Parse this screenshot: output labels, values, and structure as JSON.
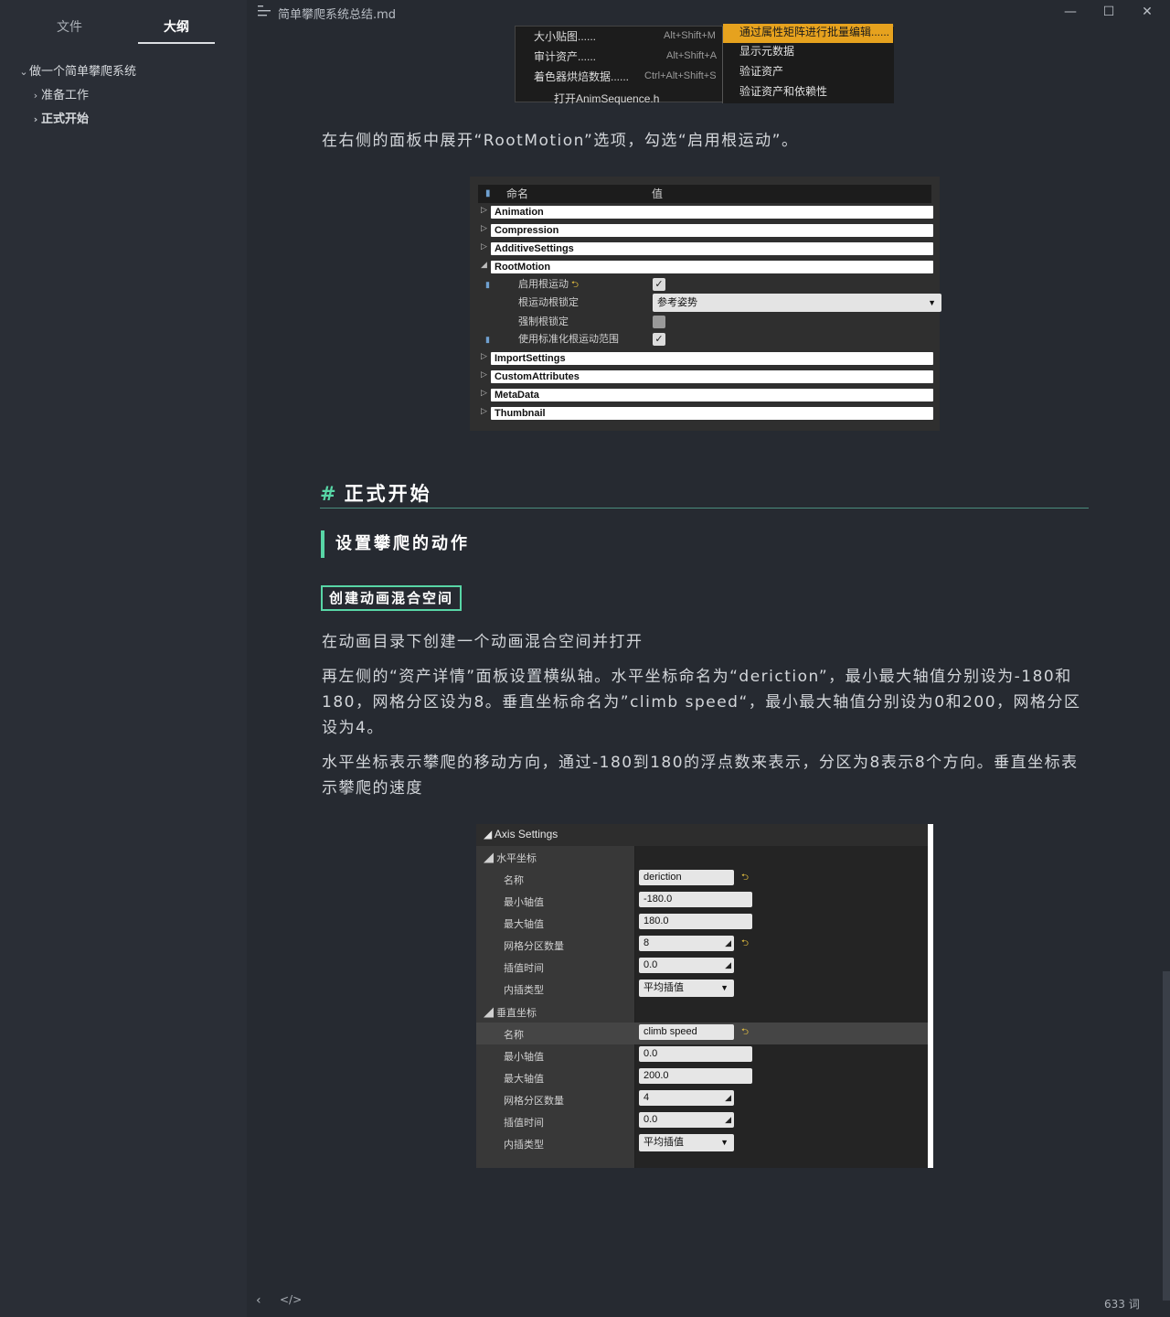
{
  "sidebar": {
    "tabs": [
      "文件",
      "大纲"
    ],
    "outline": [
      {
        "label": "做一个简单攀爬系统",
        "chevron": "⌄"
      },
      {
        "label": "准备工作",
        "chevron": "›"
      },
      {
        "label": "正式开始",
        "chevron": "›"
      }
    ]
  },
  "titlebar": {
    "filename": "简单攀爬系统总结.md",
    "min": "—",
    "max": "☐",
    "close": "✕"
  },
  "menu_image": {
    "items": [
      {
        "label": "大小贴图......",
        "shortcut": "Alt+Shift+M"
      },
      {
        "label": "审计资产......",
        "shortcut": "Alt+Shift+A"
      },
      {
        "label": "着色器烘焙数据......",
        "shortcut": "Ctrl+Alt+Shift+S"
      },
      {
        "label": "打开AnimSequence.h",
        "shortcut": ""
      }
    ],
    "submenu": [
      "通过属性矩阵进行批量编辑......",
      "显示元数据",
      "验证资产",
      "验证资产和依赖性"
    ]
  },
  "text": {
    "p_rootmotion": "在右侧的面板中展开“RootMotion”选项，勾选“启用根运动”。",
    "h1": "正式开始",
    "h1_hash": "#",
    "h2": "设置攀爬的动作",
    "h3": "创建动画混合空间",
    "p1": "在动画目录下创建一个动画混合空间并打开",
    "p2": "再左侧的“资产详情”面板设置横纵轴。水平坐标命名为“deriction”，最小最大轴值分别设为-180和180，网格分区设为8。垂直坐标命名为”climb speed“，最小最大轴值分别设为0和200，网格分区设为4。",
    "p3": "水平坐标表示攀爬的移动方向，通过-180到180的浮点数来表示，分区为8表示8个方向。垂直坐标表示攀爬的速度"
  },
  "rootmotion_panel": {
    "col_name": "命名",
    "col_value": "值",
    "categories_top": [
      "Animation",
      "Compression",
      "AdditiveSettings",
      "RootMotion"
    ],
    "props": [
      {
        "name": "启用根运动",
        "checked": true
      },
      {
        "name": "根运动根锁定",
        "select": "参考姿势"
      },
      {
        "name": "强制根锁定",
        "checked": false
      },
      {
        "name": "使用标准化根运动范围",
        "checked": true
      }
    ],
    "categories_bottom": [
      "ImportSettings",
      "CustomAttributes",
      "MetaData",
      "Thumbnail"
    ]
  },
  "axis_panel": {
    "title": "Axis Settings",
    "horizontal": {
      "section": "水平坐标",
      "rows": [
        {
          "label": "名称",
          "value": "deriction"
        },
        {
          "label": "最小轴值",
          "value": "-180.0"
        },
        {
          "label": "最大轴值",
          "value": "180.0"
        },
        {
          "label": "网格分区数量",
          "value": "8"
        },
        {
          "label": "插值时间",
          "value": "0.0"
        },
        {
          "label": "内插类型",
          "value": "平均插值"
        }
      ]
    },
    "vertical": {
      "section": "垂直坐标",
      "rows": [
        {
          "label": "名称",
          "value": "climb speed"
        },
        {
          "label": "最小轴值",
          "value": "0.0"
        },
        {
          "label": "最大轴值",
          "value": "200.0"
        },
        {
          "label": "网格分区数量",
          "value": "4"
        },
        {
          "label": "插值时间",
          "value": "0.0"
        },
        {
          "label": "内插类型",
          "value": "平均插值"
        }
      ]
    }
  },
  "statusbar": {
    "words": "633 词",
    "prev": "‹",
    "source": "</>"
  }
}
